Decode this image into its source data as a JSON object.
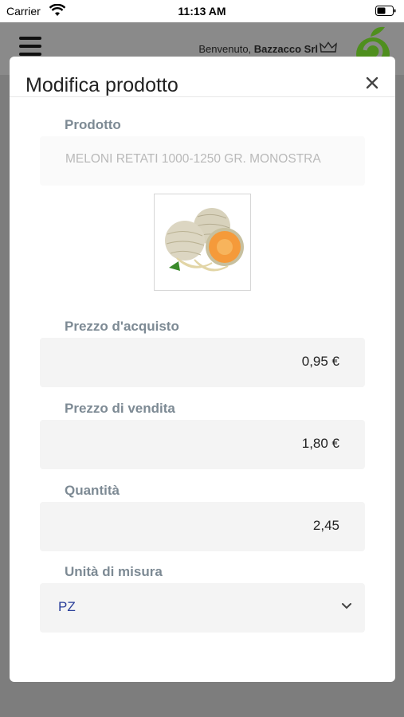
{
  "status": {
    "carrier": "Carrier",
    "time": "11:13 AM"
  },
  "header": {
    "welcome_prefix": "Benvenuto,",
    "user_name": "Bazzacco Srl"
  },
  "modal": {
    "title": "Modifica prodotto",
    "product_label": "Prodotto",
    "product_value": "MELONI RETATI 1000-1250 GR. MONOSTRA",
    "purchase_price_label": "Prezzo d'acquisto",
    "purchase_price_value": "0,95 €",
    "sale_price_label": "Prezzo di vendita",
    "sale_price_value": "1,80 €",
    "quantity_label": "Quantità",
    "quantity_value": "2,45",
    "unit_label": "Unità di misura",
    "unit_value": "PZ"
  },
  "colors": {
    "accent": "#2a3f9a",
    "label": "#7d8a94",
    "logo_green": "#4f8f1e"
  },
  "icons": [
    "wifi-icon",
    "battery-icon",
    "menu-icon",
    "crown-icon",
    "brand-logo",
    "close-icon",
    "chevron-down-icon"
  ]
}
